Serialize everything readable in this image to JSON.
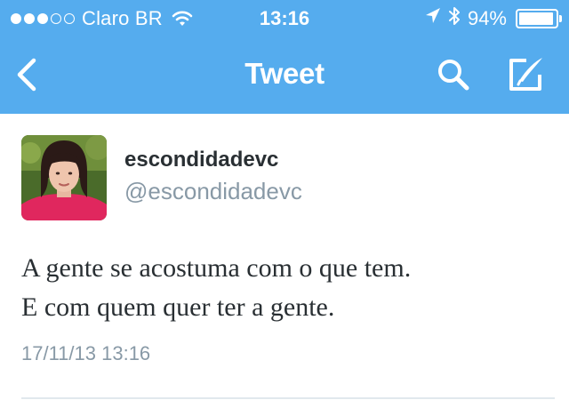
{
  "status_bar": {
    "carrier": "Claro BR",
    "time": "13:16",
    "battery_text": "94%",
    "battery_level": 0.94,
    "signal_bars_filled": 3,
    "signal_bars_total": 5
  },
  "nav": {
    "title": "Tweet",
    "icons": [
      "chevron-left-icon",
      "search-icon",
      "compose-icon"
    ]
  },
  "tweet": {
    "display_name": "escondidadevc",
    "handle": "@escondidadevc",
    "text_lines": [
      "A gente se acostuma com o que tem.",
      "E com quem quer ter a gente."
    ],
    "timestamp": "17/11/13 13:16"
  },
  "colors": {
    "bar": "#55acee",
    "text": "#292f33",
    "secondary": "#8899a6"
  }
}
